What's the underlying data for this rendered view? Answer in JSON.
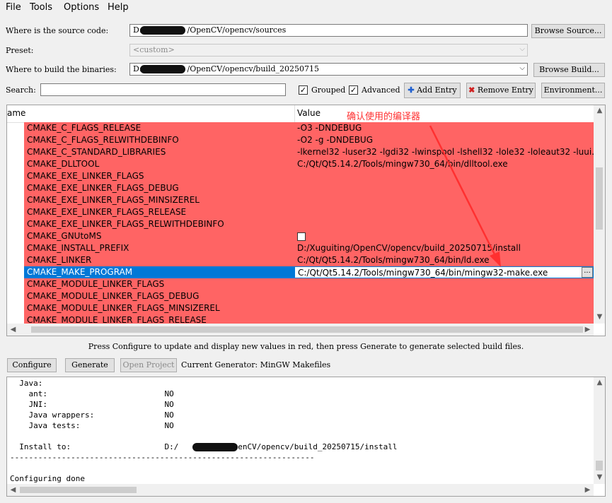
{
  "menu": [
    "File",
    "Tools",
    "Options",
    "Help"
  ],
  "source": {
    "label": "Where is the source code:",
    "value_prefix": "D:",
    "value_suffix": "/OpenCV/opencv/sources",
    "browse": "Browse Source..."
  },
  "preset": {
    "label": "Preset:",
    "value": "<custom>"
  },
  "build": {
    "label": "Where to build the binaries:",
    "value_prefix": "D:",
    "value_suffix": "/OpenCV/opencv/build_20250715",
    "browse": "Browse Build..."
  },
  "search": {
    "label": "Search:",
    "value": "",
    "grouped": "Grouped",
    "advanced": "Advanced",
    "add_entry": "Add Entry",
    "remove_entry": "Remove Entry",
    "environment": "Environment..."
  },
  "tree": {
    "col_name": "ame",
    "col_value": "Value",
    "rows": [
      {
        "name": "CMAKE_C_FLAGS_RELEASE",
        "value": "-O3 -DNDEBUG"
      },
      {
        "name": "CMAKE_C_FLAGS_RELWITHDEBINFO",
        "value": "-O2 -g -DNDEBUG"
      },
      {
        "name": "CMAKE_C_STANDARD_LIBRARIES",
        "value": "-lkernel32 -luser32 -lgdi32 -lwinspool -lshell32 -lole32 -loleaut32 -luui..."
      },
      {
        "name": "CMAKE_DLLTOOL",
        "value": "C:/Qt/Qt5.14.2/Tools/mingw730_64/bin/dlltool.exe"
      },
      {
        "name": "CMAKE_EXE_LINKER_FLAGS",
        "value": ""
      },
      {
        "name": "CMAKE_EXE_LINKER_FLAGS_DEBUG",
        "value": ""
      },
      {
        "name": "CMAKE_EXE_LINKER_FLAGS_MINSIZEREL",
        "value": ""
      },
      {
        "name": "CMAKE_EXE_LINKER_FLAGS_RELEASE",
        "value": ""
      },
      {
        "name": "CMAKE_EXE_LINKER_FLAGS_RELWITHDEBINFO",
        "value": ""
      },
      {
        "name": "CMAKE_GNUtoMS",
        "value": ""
      },
      {
        "name": "CMAKE_INSTALL_PREFIX",
        "value": "D:/Xuguiting/OpenCV/opencv/build_20250715/install"
      },
      {
        "name": "CMAKE_LINKER",
        "value": "C:/Qt/Qt5.14.2/Tools/mingw730_64/bin/ld.exe"
      },
      {
        "name": "CMAKE_MAKE_PROGRAM",
        "value": "C:/Qt/Qt5.14.2/Tools/mingw730_64/bin/mingw32-make.exe"
      },
      {
        "name": "CMAKE_MODULE_LINKER_FLAGS",
        "value": ""
      },
      {
        "name": "CMAKE_MODULE_LINKER_FLAGS_DEBUG",
        "value": ""
      },
      {
        "name": "CMAKE_MODULE_LINKER_FLAGS_MINSIZEREL",
        "value": ""
      },
      {
        "name": "CMAKE_MODULE_LINKER_FLAGS_RELEASE",
        "value": ""
      }
    ],
    "edit_button": "..."
  },
  "annotation": "确认使用的编译器",
  "colors": {
    "changed_row": "#ff6464",
    "selection": "#0078d7",
    "annotation": "#ff3030"
  },
  "hint": "Press Configure to update and display new values in red, then press Generate to generate selected build files.",
  "actions": {
    "configure": "Configure",
    "generate": "Generate",
    "open_project": "Open Project",
    "current_generator": "Current Generator: MinGW Makefiles"
  },
  "output": {
    "lines": [
      "  Java:",
      "    ant:                         NO",
      "    JNI:                         NO",
      "    Java wrappers:               NO",
      "    Java tests:                  NO",
      "",
      "  Install to:                    D:/",
      "-----------------------------------------------------------------",
      "",
      "Configuring done"
    ],
    "install_suffix": "/OpenCV/opencv/build_20250715/install"
  }
}
